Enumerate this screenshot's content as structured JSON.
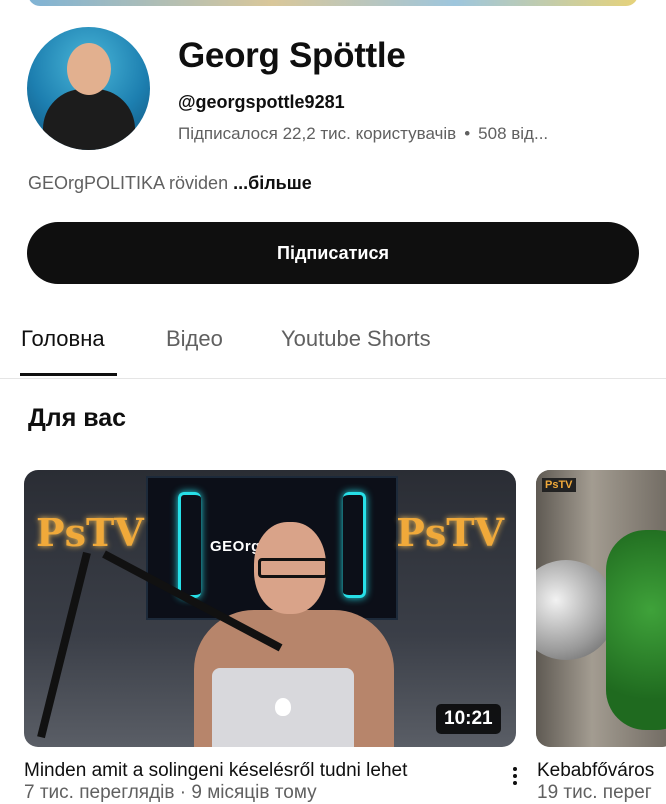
{
  "channel": {
    "name": "Georg Spöttle",
    "handle": "@georgspottle9281",
    "subscribers": "Підписалося 22,2 тис. користувачів",
    "separator": "•",
    "video_count": "508 від...",
    "description": "GEOrgPOLITIKA röviden",
    "more_label": "...більше",
    "subscribe_label": "Підписатися"
  },
  "tabs": [
    {
      "label": "Головна",
      "active": true
    },
    {
      "label": "Відео",
      "active": false
    },
    {
      "label": "Youtube Shorts",
      "active": false
    }
  ],
  "section": {
    "title": "Для вас"
  },
  "videos": [
    {
      "title": "Minden amit a solingeni késelésről tudni lehet",
      "meta": "7 тис. переглядів · 9 місяців тому",
      "duration": "10:21",
      "thumb_text": "GEOrg   IKA",
      "thumb_logo": "PsTV"
    },
    {
      "title": "Kebabfőváros",
      "meta": "19 тис. перег",
      "thumb_logo": "PsTV"
    }
  ],
  "colors": {
    "accent": "#0f0f0f",
    "secondary_text": "#606060",
    "neon": "#27e0e8",
    "logo": "#f0a93a"
  }
}
